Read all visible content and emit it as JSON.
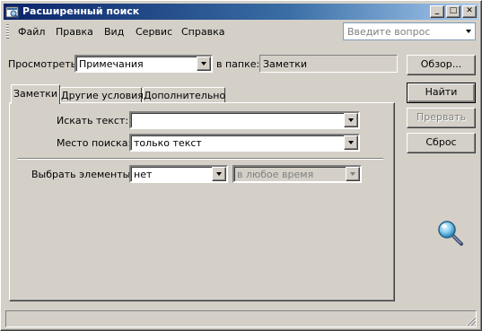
{
  "window": {
    "title": "Расширенный поиск",
    "minimize_label": "_",
    "maximize_label": "□",
    "close_label": "✕"
  },
  "menu": {
    "items": [
      "Файл",
      "Правка",
      "Вид",
      "Сервис",
      "Справка"
    ],
    "ask_placeholder": "Введите вопрос"
  },
  "lookin": {
    "label": "Просмотреть:",
    "value": "Примечания",
    "folder_label": "в папке:",
    "folder_value": "Заметки",
    "browse_label": "Обзор..."
  },
  "tabs": [
    "Заметки",
    "Другие условия",
    "Дополнительно"
  ],
  "form": {
    "search_text_label": "Искать текст:",
    "search_text_value": "",
    "search_in_label": "Место поиска:",
    "search_in_value": "только текст",
    "choose_items_label": "Выбрать элементы:",
    "choose_items_value": "нет",
    "time_value": "в любое время"
  },
  "buttons": {
    "find": "Найти",
    "stop": "Прервать",
    "reset": "Сброс"
  },
  "icons": {
    "app": "find-window-icon",
    "magnifier": "magnifier-icon"
  },
  "colors": {
    "title_gradient_start": "#0a246a",
    "title_gradient_end": "#a6caf0",
    "face": "#d4d0c8"
  }
}
